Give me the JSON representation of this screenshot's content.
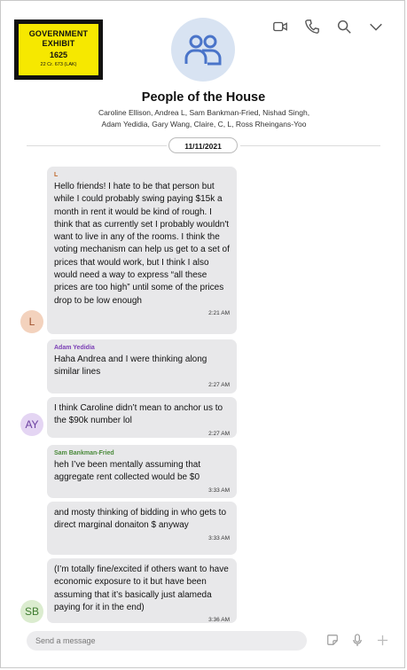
{
  "exhibit": {
    "line1": "GOVERNMENT",
    "line2": "EXHIBIT",
    "number": "1625",
    "case": "22 Cr. 673 (LAK)",
    "color": "#f6e800"
  },
  "header": {
    "icons": [
      "video-call-icon",
      "phone-icon",
      "search-icon",
      "chevron-down-icon"
    ],
    "group_icon": "people-icon",
    "title": "People of the House",
    "members_line1": "Caroline Ellison, Andrea L, Sam Bankman-Fried, Nishad Singh,",
    "members_line2": "Adam Yedidia, Gary Wang, Claire, C, L, Ross Rheingans-Yoo",
    "date": "11/11/2021"
  },
  "messages": [
    {
      "sender": "L",
      "sender_color": "#c0672a",
      "text": "Hello friends! I hate to be that person but while I could probably swing paying $15k a month in rent it would be kind of rough. I think that as currently set I probably wouldn't want to live in any of the rooms. I think the voting mechanism can help us get to a set of prices that would work, but I think I also would need a way to express “all these prices are too high” until some of the prices drop to be low enough",
      "time": "2:21 AM"
    },
    {
      "sender": "Adam Yedidia",
      "sender_color": "#7b3fb5",
      "text": "Haha Andrea and I were thinking along similar lines",
      "time": "2:27 AM"
    },
    {
      "sender": "",
      "text": "I think Caroline didn’t mean to anchor us to the $90k number lol",
      "time": "2:27 AM"
    },
    {
      "sender": "Sam Bankman-Fried",
      "sender_color": "#4a8a3a",
      "text": "heh I’ve been mentally assuming that aggregate rent collected would be $0",
      "time": "3:33 AM"
    },
    {
      "sender": "",
      "text": "and mosty thinking of bidding in who gets to direct marginal donaiton $ anyway",
      "time": "3:33 AM"
    },
    {
      "sender": "",
      "text": "(I’m totally fine/excited if others want to have economic exposure to it but have been assuming that it’s basically just alameda paying for it in the end)",
      "time": "3:36 AM"
    }
  ],
  "avatars": [
    {
      "initials": "L",
      "bg": "#f3d2bd",
      "fg": "#a0522d"
    },
    {
      "initials": "AY",
      "bg": "#e4d5f3",
      "fg": "#6b3fa0"
    },
    {
      "initials": "SB",
      "bg": "#dbeccf",
      "fg": "#3d7a2e"
    }
  ],
  "composer": {
    "placeholder": "Send a message",
    "icons": [
      "sticker-icon",
      "microphone-icon",
      "plus-icon"
    ]
  }
}
